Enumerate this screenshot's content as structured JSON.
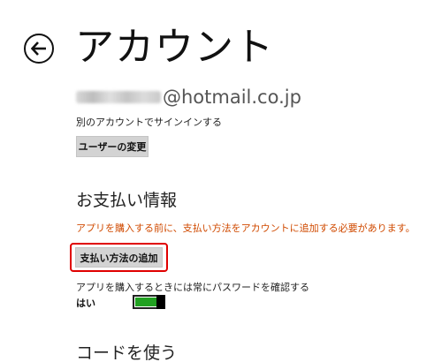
{
  "header": {
    "title": "アカウント",
    "back_icon": "back-arrow-icon"
  },
  "account": {
    "email_domain": "@hotmail.co.jp",
    "switch_text": "別のアカウントでサインインする",
    "change_user_label": "ユーザーの変更"
  },
  "payment": {
    "heading": "お支払い情報",
    "warning": "アプリを購入する前に、支払い方法をアカウントに追加する必要があります。",
    "warning_color": "#d04a00",
    "add_payment_label": "支払い方法の追加",
    "highlight_color": "#e00000"
  },
  "password_setting": {
    "label": "アプリを購入するときには常にパスワードを確認する",
    "toggle_state": "はい",
    "toggle_on": true,
    "toggle_color": "#21a121"
  },
  "code": {
    "heading": "コードを使う"
  }
}
